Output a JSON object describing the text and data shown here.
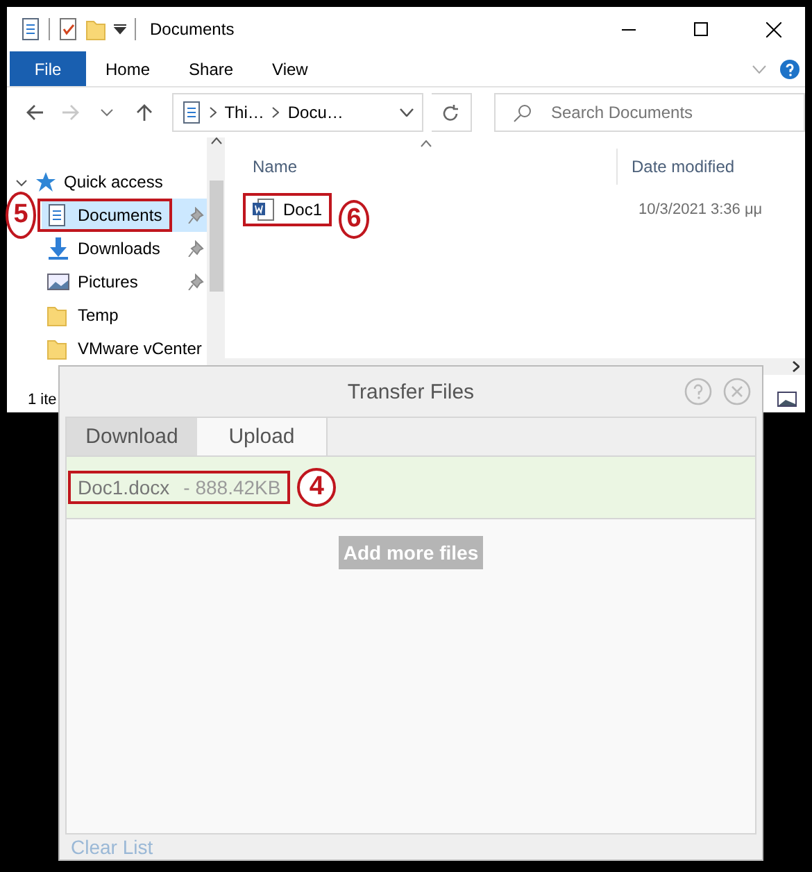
{
  "window": {
    "title": "Documents"
  },
  "ribbon": {
    "file_button": "File",
    "tabs": [
      "Home",
      "Share",
      "View"
    ]
  },
  "address": {
    "crumbs": [
      "Thi…",
      "Docu…"
    ]
  },
  "search": {
    "placeholder": "Search Documents"
  },
  "navigation": {
    "items": [
      {
        "label": "Quick access",
        "kind": "quick_access",
        "expanded": true,
        "children": [
          {
            "label": "Documents",
            "kind": "documents",
            "selected": true,
            "pinned": true,
            "callout": "5"
          },
          {
            "label": "Downloads",
            "kind": "downloads",
            "selected": false,
            "pinned": true
          },
          {
            "label": "Pictures",
            "kind": "pictures",
            "selected": false,
            "pinned": true
          },
          {
            "label": "Temp",
            "kind": "folder",
            "selected": false,
            "pinned": false
          },
          {
            "label": "VMware vCenter",
            "kind": "folder",
            "selected": false,
            "pinned": false
          }
        ]
      }
    ]
  },
  "files": {
    "columns": [
      "Name",
      "Date modified"
    ],
    "rows": [
      {
        "name": "Doc1",
        "date_modified": "10/3/2021 3:36 μμ",
        "callout": "6"
      }
    ]
  },
  "status_bar": {
    "text": "1 ite"
  },
  "dialog": {
    "title": "Transfer Files",
    "tabs": [
      {
        "label": "Download",
        "selected": false
      },
      {
        "label": "Upload",
        "selected": true
      }
    ],
    "files": [
      {
        "name": "Doc1.docx",
        "detail": "- 888.42KB",
        "callout": "4"
      }
    ],
    "add_button": "Add more files",
    "clear_link": "Clear List"
  }
}
